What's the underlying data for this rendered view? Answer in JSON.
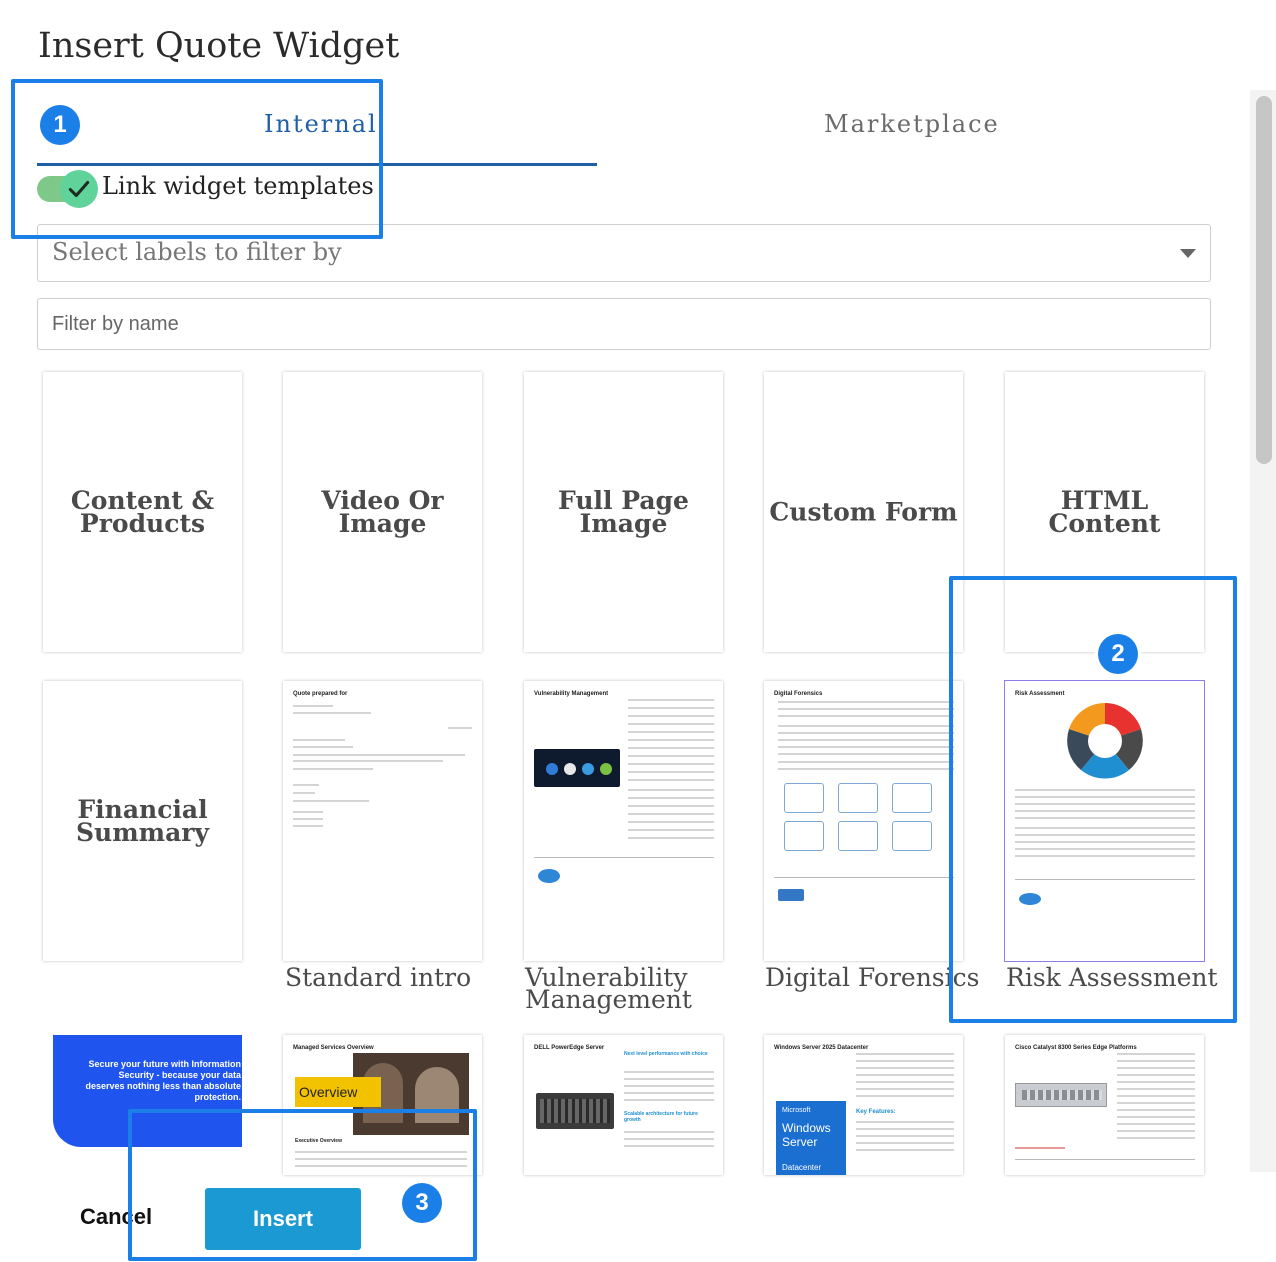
{
  "dialog": {
    "title": "Insert Quote Widget"
  },
  "tabs": [
    {
      "label": "Internal",
      "active": true
    },
    {
      "label": "Marketplace",
      "active": false
    }
  ],
  "toggle": {
    "label": "Link widget templates",
    "checked": true
  },
  "filters": {
    "labels_placeholder": "Select labels to filter by",
    "name_placeholder": "Filter by name"
  },
  "cards_row1": [
    {
      "title": "Content & Products",
      "title_line1": "Content &",
      "title_line2": "Products"
    },
    {
      "title": "Video Or Image",
      "title_line1": "Video Or",
      "title_line2": "Image"
    },
    {
      "title": "Full Page Image",
      "title_line1": "Full Page",
      "title_line2": "Image"
    },
    {
      "title": "Custom Form"
    },
    {
      "title": "HTML Content"
    }
  ],
  "cards_row2": [
    {
      "title": "Financial Summary",
      "title_line1": "Financial",
      "title_line2": "Summary"
    },
    {
      "caption": "Standard intro",
      "doc_title": "Quote prepared for"
    },
    {
      "caption_line1": "Vulnerability",
      "caption_line2": "Management",
      "doc_title": "Vulnerability Management"
    },
    {
      "caption": "Digital Forensics",
      "doc_title": "Digital Forensics"
    },
    {
      "caption": "Risk Assessment",
      "doc_title": "Risk Assessment"
    }
  ],
  "cards_row3": [
    {
      "promo_text": "Secure your future with Information Security - because your data deserves nothing less than absolute protection."
    },
    {
      "doc_title": "Managed Services Overview",
      "overlay": "Overview",
      "section": "Executive Overview"
    },
    {
      "doc_title": "DELL PowerEdge Server",
      "heading": "Next level performance with choice",
      "heading2": "Scalable architecture for future growth"
    },
    {
      "doc_title": "Windows Server 2025 Datacenter",
      "brand": "Microsoft",
      "product_line1": "Windows",
      "product_line2": "Server",
      "edition": "Datacenter",
      "features": "Key Features:"
    },
    {
      "doc_title": "Cisco Catalyst 8300 Series Edge Platforms"
    }
  ],
  "steps": [
    "1",
    "2",
    "3"
  ],
  "buttons": {
    "cancel": "Cancel",
    "insert": "Insert"
  },
  "colors": {
    "accent": "#1f5fa8",
    "highlight": "#1a7fe6",
    "insert": "#1b99d3",
    "toggle": "#5fd39a"
  }
}
